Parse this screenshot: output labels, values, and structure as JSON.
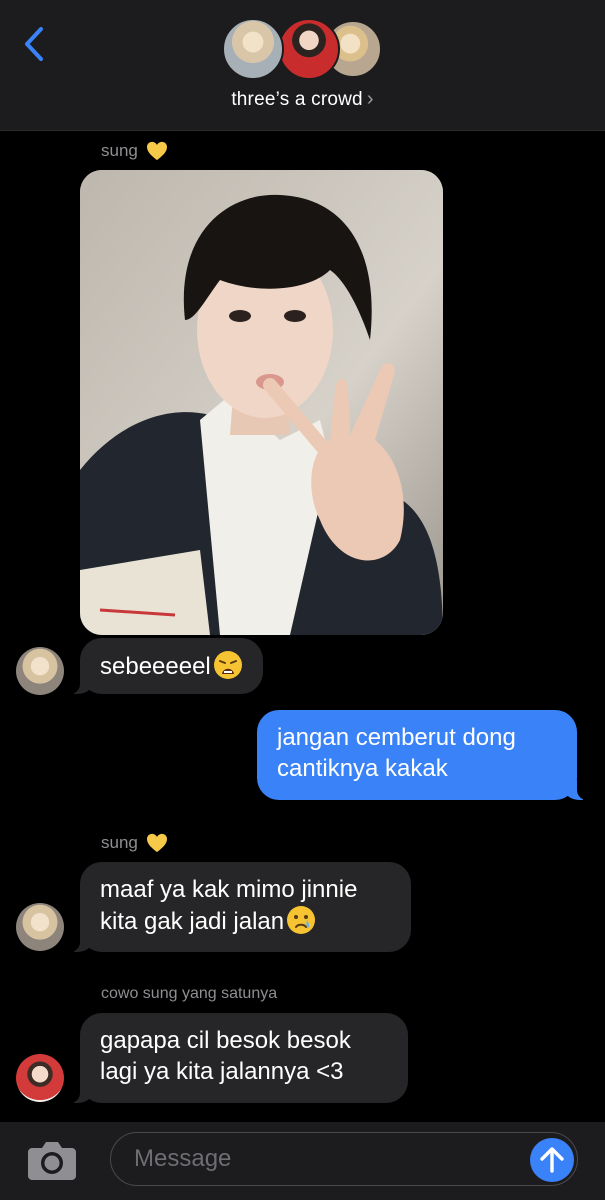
{
  "header": {
    "group_name": "three’s a crowd",
    "chevron": "›"
  },
  "messages": [
    {
      "sender": "sung",
      "type": "photo"
    },
    {
      "sender": "sung",
      "text": "sebeeeeel",
      "emoji": "weary-face"
    },
    {
      "sender": "me",
      "text_lines": [
        "jangan cemberut dong",
        "cantiknya kakak"
      ]
    },
    {
      "sender": "sung",
      "text_lines": [
        "maaf ya kak mimo jinnie",
        "kita gak jadi jalan"
      ],
      "emoji": "crying-face"
    },
    {
      "sender": "cowo sung yang satunya",
      "text_lines": [
        "gapapa cil besok besok",
        "lagi ya kita jalannya <3"
      ]
    }
  ],
  "labels": {
    "sung_1": "sung",
    "sung_2": "sung",
    "cowo": "cowo sung yang satunya"
  },
  "composer": {
    "placeholder": "Message"
  },
  "colors": {
    "accent": "#3a82f7",
    "received_bubble": "#262628",
    "background": "#000000",
    "heart": "#f7c948"
  }
}
